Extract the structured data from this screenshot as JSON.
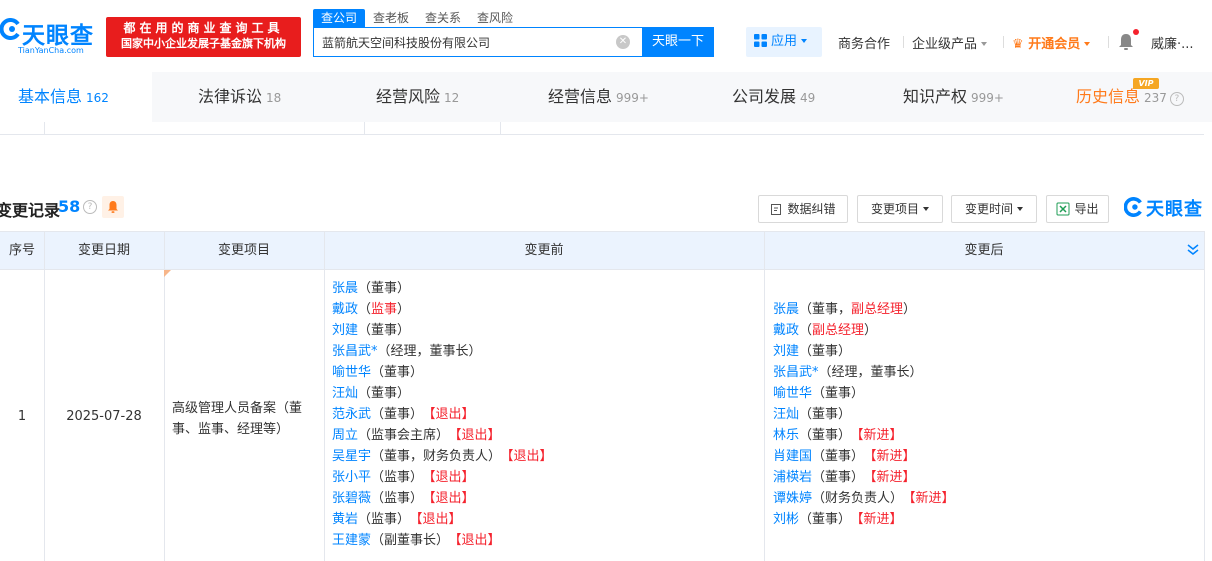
{
  "header": {
    "logo_text": "天眼查",
    "logo_sub": "TianYanCha.com",
    "promo_line1": "都在用的商业查询工具",
    "promo_line2": "国家中小企业发展子基金旗下机构",
    "search_tabs": [
      "查公司",
      "查老板",
      "查关系",
      "查风险"
    ],
    "search_value": "蓝箭航天空间科技股份有限公司",
    "search_button": "天眼一下",
    "apps": "应用",
    "business": "商务合作",
    "enterprise": "企业级产品",
    "vip": "开通会员",
    "user": "威廉·..."
  },
  "tabs": [
    {
      "label": "基本信息",
      "count": "162"
    },
    {
      "label": "法律诉讼",
      "count": "18"
    },
    {
      "label": "经营风险",
      "count": "12"
    },
    {
      "label": "经营信息",
      "count": "999+"
    },
    {
      "label": "公司发展",
      "count": "49"
    },
    {
      "label": "知识产权",
      "count": "999+"
    },
    {
      "label": "历史信息",
      "count": "237"
    }
  ],
  "vip_badge": "VIP",
  "section": {
    "title": "变更记录",
    "count": "58",
    "buttons": {
      "report": "数据纠错",
      "item": "变更项目",
      "time": "变更时间",
      "export": "导出"
    },
    "brand": "天眼查"
  },
  "table": {
    "headers": {
      "no": "序号",
      "date": "变更日期",
      "item": "变更项目",
      "before": "变更前",
      "after": "变更后"
    },
    "row": {
      "no": "1",
      "date": "2025-07-28",
      "item": "高级管理人员备案（董事、监事、经理等）",
      "before": [
        {
          "name": "张晨",
          "pre": "（",
          "role": "董事",
          "roleRed": "",
          "post": "）",
          "tag": ""
        },
        {
          "name": "戴政",
          "pre": "（",
          "role": "",
          "roleRed": "监事",
          "post": "）",
          "tag": ""
        },
        {
          "name": "刘建",
          "pre": "（",
          "role": "董事",
          "roleRed": "",
          "post": "）",
          "tag": ""
        },
        {
          "name": "张昌武*",
          "pre": "（",
          "role": "经理，董事长",
          "roleRed": "",
          "post": "）",
          "tag": ""
        },
        {
          "name": "喻世华",
          "pre": "（",
          "role": "董事",
          "roleRed": "",
          "post": "）",
          "tag": ""
        },
        {
          "name": "汪灿",
          "pre": "（",
          "role": "董事",
          "roleRed": "",
          "post": "）",
          "tag": ""
        },
        {
          "name": "范永武",
          "pre": "（",
          "role": "董事",
          "roleRed": "",
          "post": "）",
          "tag": "【退出】"
        },
        {
          "name": "周立",
          "pre": "（",
          "role": "监事会主席",
          "roleRed": "",
          "post": "）",
          "tag": "【退出】"
        },
        {
          "name": "吴星宇",
          "pre": "（",
          "role": "董事，财务负责人",
          "roleRed": "",
          "post": "）",
          "tag": "【退出】"
        },
        {
          "name": "张小平",
          "pre": "（",
          "role": "监事",
          "roleRed": "",
          "post": "）",
          "tag": "【退出】"
        },
        {
          "name": "张碧薇",
          "pre": "（",
          "role": "监事",
          "roleRed": "",
          "post": "）",
          "tag": "【退出】"
        },
        {
          "name": "黄岩",
          "pre": "（",
          "role": "监事",
          "roleRed": "",
          "post": "）",
          "tag": "【退出】"
        },
        {
          "name": "王建蒙",
          "pre": "（",
          "role": "副董事长",
          "roleRed": "",
          "post": "）",
          "tag": "【退出】"
        }
      ],
      "after": [
        {
          "name": "张晨",
          "pre": "（",
          "role": "董事，",
          "roleRed": "副总经理",
          "post": "）",
          "tag": ""
        },
        {
          "name": "戴政",
          "pre": "（",
          "role": "",
          "roleRed": "副总经理",
          "post": "）",
          "tag": ""
        },
        {
          "name": "刘建",
          "pre": "（",
          "role": "董事",
          "roleRed": "",
          "post": "）",
          "tag": ""
        },
        {
          "name": "张昌武*",
          "pre": "（",
          "role": "经理，董事长",
          "roleRed": "",
          "post": "）",
          "tag": ""
        },
        {
          "name": "喻世华",
          "pre": "（",
          "role": "董事",
          "roleRed": "",
          "post": "）",
          "tag": ""
        },
        {
          "name": "汪灿",
          "pre": "（",
          "role": "董事",
          "roleRed": "",
          "post": "）",
          "tag": ""
        },
        {
          "name": "林乐",
          "pre": "（",
          "role": "董事",
          "roleRed": "",
          "post": "）",
          "tag": "【新进】"
        },
        {
          "name": "肖建国",
          "pre": "（",
          "role": "董事",
          "roleRed": "",
          "post": "）",
          "tag": "【新进】"
        },
        {
          "name": "浦楧岩",
          "pre": "（",
          "role": "董事",
          "roleRed": "",
          "post": "）",
          "tag": "【新进】"
        },
        {
          "name": "谭姝婷",
          "pre": "（",
          "role": "财务负责人",
          "roleRed": "",
          "post": "）",
          "tag": "【新进】"
        },
        {
          "name": "刘彬",
          "pre": "（",
          "role": "董事",
          "roleRed": "",
          "post": "）",
          "tag": "【新进】"
        }
      ]
    }
  },
  "colors": {
    "brand": "#0084ff",
    "red": "#f5222d",
    "vip": "#ff7a1a",
    "header_bg": "#ebf3fe"
  }
}
